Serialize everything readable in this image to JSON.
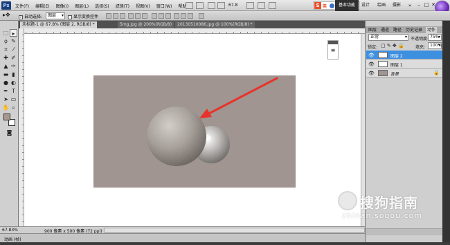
{
  "menubar": {
    "app_logo": "Ps",
    "items": [
      "文件(F)",
      "编辑(E)",
      "图像(I)",
      "图层(L)",
      "选择(S)",
      "滤镜(T)",
      "视图(V)",
      "窗口(W)",
      "帮助(H)"
    ],
    "zoom": "67.8",
    "ime_label": "英",
    "workspaces": [
      "基本功能",
      "设计",
      "绘画",
      "摄影"
    ],
    "window_controls": [
      "–",
      "□",
      "✕"
    ]
  },
  "options": {
    "auto_select_label": "自动选择:",
    "auto_select_value": "图层",
    "show_transform_label": "显示变换控件"
  },
  "tabs": [
    "未标题-1 @ 67.8% (图层 2, RGB/8) *",
    "5mg.jpg @ 200%(RGB/8)",
    "20130510086.jpg @ 100%(RGB/8) *"
  ],
  "status": {
    "zoom": "67.83%",
    "doc_size": "900 像素 x 500 像素 (72 ppi)"
  },
  "anim_panel": {
    "label": "动画 (帧)"
  },
  "panels": {
    "tabs": [
      "图层",
      "通道",
      "路径",
      "历史记录",
      "动作"
    ],
    "active_tab": "图层",
    "blend_mode": "正常",
    "opacity_label": "不透明度:",
    "opacity_value": "75%",
    "lock_label": "锁定:",
    "fill_label": "填充:",
    "fill_value": "100%",
    "layers": [
      {
        "name": "图层 2",
        "selected": true
      },
      {
        "name": "图层 1",
        "selected": false
      },
      {
        "name": "背景",
        "selected": false,
        "locked": true
      }
    ]
  },
  "canvas": {
    "background_color": "#a09590",
    "arrow_color": "#e8322b"
  },
  "watermark": {
    "text": "搜狗指南",
    "url": "zhinan.sogou.com"
  },
  "colors": {
    "foreground": "#a8998f",
    "background": "#ffffff",
    "layer_selected": "#3d8fe0"
  }
}
